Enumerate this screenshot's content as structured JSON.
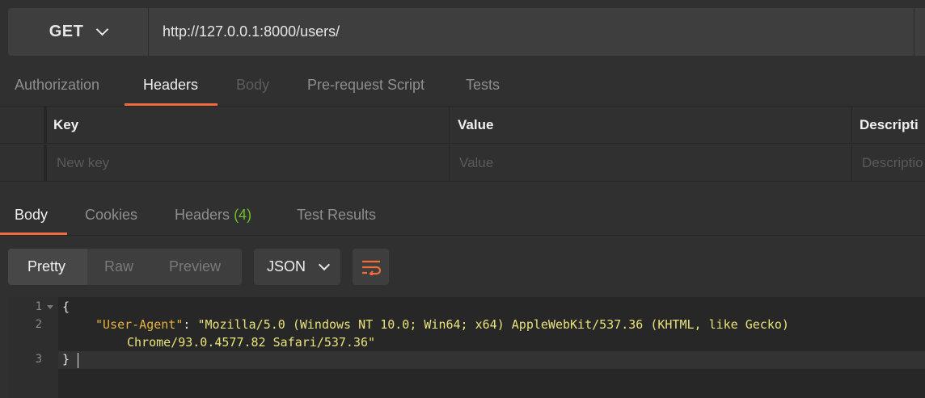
{
  "request": {
    "method": "GET",
    "url": "http://127.0.0.1:8000/users/"
  },
  "request_tabs": [
    "Authorization",
    "Headers",
    "Body",
    "Pre-request Script",
    "Tests"
  ],
  "headers_table": {
    "columns": [
      "Key",
      "Value",
      "Descripti"
    ],
    "placeholders": [
      "New key",
      "Value",
      "Descriptio"
    ]
  },
  "response_tabs": {
    "body": "Body",
    "cookies": "Cookies",
    "headers": "Headers",
    "headers_count": "(4)",
    "test_results": "Test Results"
  },
  "format_tabs": [
    "Pretty",
    "Raw",
    "Preview"
  ],
  "format_select": "JSON",
  "code": {
    "line_numbers": [
      "1",
      "2",
      "3"
    ],
    "open_brace": "{",
    "key": "\"User-Agent\"",
    "separator": ": ",
    "value_line1": "\"Mozilla/5.0 (Windows NT 10.0; Win64; x64) AppleWebKit/537.36 (KHTML, like Gecko)",
    "value_line2": "Chrome/93.0.4577.82 Safari/537.36\"",
    "close_brace": "}"
  },
  "colors": {
    "accent": "#f26b3a",
    "badge": "#6bbf2a",
    "json_key": "#e6b33c",
    "json_string": "#e9e37a"
  },
  "icons": [
    "chevron-down-icon",
    "wrap-lines-icon",
    "fold-arrow-icon"
  ]
}
